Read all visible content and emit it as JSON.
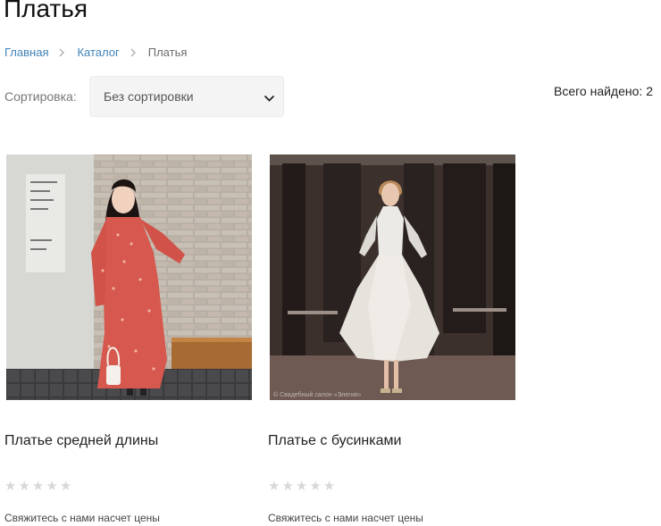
{
  "page": {
    "title": "Платья"
  },
  "breadcrumb": {
    "items": [
      "Главная",
      "Каталог"
    ],
    "current": "Платья"
  },
  "sort": {
    "label": "Сортировка:",
    "value": "Без сортировки"
  },
  "results": {
    "total_label": "Всего найдено:",
    "total_count": "2"
  },
  "products": [
    {
      "title": "Платье средней длины",
      "rating": 0,
      "price_note": "Свяжитесь с нами насчет цены",
      "image_icon": "red-floral-dress-photo"
    },
    {
      "title": "Платье с бусинками",
      "rating": 0,
      "price_note": "Свяжитесь с нами насчет цены",
      "image_icon": "white-beaded-dress-photo"
    }
  ],
  "colors": {
    "link": "#3f82b8",
    "star_empty": "#d8d8d8",
    "select_bg": "#f4f4f4"
  }
}
